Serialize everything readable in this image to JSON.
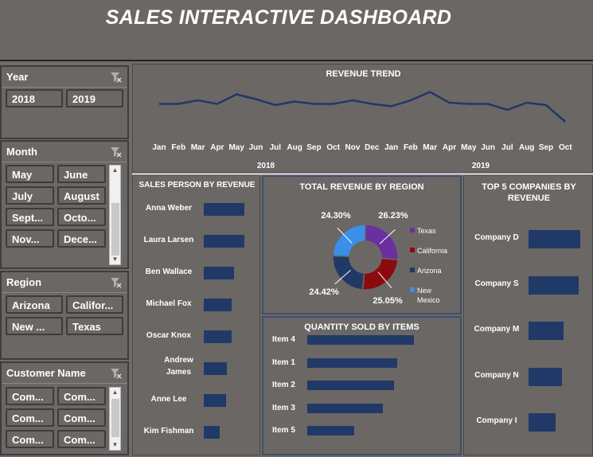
{
  "title": "SALES INTERACTIVE DASHBOARD",
  "slicers": {
    "year": {
      "label": "Year",
      "items": [
        "2018",
        "2019"
      ]
    },
    "month": {
      "label": "Month",
      "items": [
        "May",
        "June",
        "July",
        "August",
        "Sept...",
        "Octo...",
        "Nov...",
        "Dece..."
      ]
    },
    "region": {
      "label": "Region",
      "items": [
        "Arizona",
        "Califor...",
        "New ...",
        "Texas"
      ]
    },
    "customer": {
      "label": "Customer Name",
      "items": [
        "Com...",
        "Com...",
        "Com...",
        "Com...",
        "Com...",
        "Com..."
      ]
    }
  },
  "revenue_trend": {
    "title": "REVENUE TREND",
    "months": [
      "Jan",
      "Feb",
      "Mar",
      "Apr",
      "May",
      "Jun",
      "Jul",
      "Aug",
      "Sep",
      "Oct",
      "Nov",
      "Dec",
      "Jan",
      "Feb",
      "Mar",
      "Apr",
      "May",
      "Jun",
      "Jul",
      "Aug",
      "Sep",
      "Oct"
    ],
    "years": [
      "2018",
      "2019"
    ],
    "chart_data": {
      "type": "line",
      "x": [
        "Jan",
        "Feb",
        "Mar",
        "Apr",
        "May",
        "Jun",
        "Jul",
        "Aug",
        "Sep",
        "Oct",
        "Nov",
        "Dec",
        "Jan",
        "Feb",
        "Mar",
        "Apr",
        "May",
        "Jun",
        "Jul",
        "Aug",
        "Sep",
        "Oct"
      ],
      "values": [
        72,
        72,
        75,
        72,
        80,
        76,
        71,
        74,
        72,
        72,
        75,
        72,
        70,
        75,
        82,
        73,
        72,
        72,
        67,
        73,
        71,
        57
      ],
      "color": "#213966"
    }
  },
  "sales_person": {
    "title": "SALES PERSON BY REVENUE",
    "chart_data": {
      "type": "bar",
      "categories": [
        "Anna Weber",
        "Laura Larsen",
        "Ben Wallace",
        "Michael Fox",
        "Oscar Knox",
        "Andrew James",
        "Anne Lee",
        "Kim Fishman"
      ],
      "values": [
        100,
        100,
        74,
        68,
        68,
        56,
        54,
        40
      ]
    },
    "labels": [
      "Anna Weber",
      "Laura Larsen",
      "Ben Wallace",
      "Michael Fox",
      "Oscar Knox",
      "Andrew",
      "James",
      "Anne Lee",
      "Kim Fishman"
    ]
  },
  "region_revenue": {
    "title": "TOTAL REVENUE BY REGION",
    "chart_data": {
      "type": "pie",
      "categories": [
        "Texas",
        "California",
        "Arizona",
        "New Mexico"
      ],
      "values": [
        26.23,
        25.05,
        24.42,
        24.3
      ],
      "colors": [
        "#6b2fa0",
        "#8b0a0e",
        "#213966",
        "#3b8fe8"
      ]
    },
    "value_labels": [
      "26.23%",
      "25.05%",
      "24.42%",
      "24.30%"
    ],
    "legend": [
      "Texas",
      "California",
      "Arizona",
      "New",
      "Mexico"
    ]
  },
  "quantity": {
    "title": "QUANTITY SOLD BY ITEMS",
    "chart_data": {
      "type": "bar",
      "categories": [
        "Item 4",
        "Item 1",
        "Item 2",
        "Item 3",
        "Item 5"
      ],
      "values": [
        100,
        84,
        81,
        71,
        44
      ]
    }
  },
  "top_companies": {
    "title_line1": "TOP 5 COMPANIES BY",
    "title_line2": "REVENUE",
    "chart_data": {
      "type": "bar",
      "categories": [
        "Company D",
        "Company S",
        "Company M",
        "Company N",
        "Company I"
      ],
      "values": [
        100,
        97,
        68,
        64,
        53
      ]
    }
  }
}
